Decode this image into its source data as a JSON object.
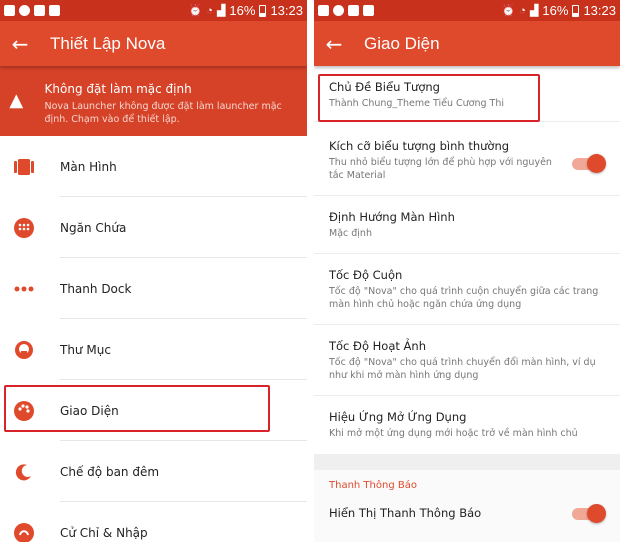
{
  "status_bar": {
    "battery": "16%",
    "time": "13:23"
  },
  "left": {
    "title": "Thiết Lập Nova",
    "warning": {
      "title": "Không đặt làm mặc định",
      "subtitle": "Nova Launcher không được đặt làm launcher mặc định. Chạm vào để thiết lập."
    },
    "items": [
      {
        "label": "Màn Hình"
      },
      {
        "label": "Ngăn Chứa"
      },
      {
        "label": "Thanh Dock"
      },
      {
        "label": "Thư Mục"
      },
      {
        "label": "Giao Diện"
      },
      {
        "label": "Chế độ ban đêm"
      },
      {
        "label": "Cử Chỉ & Nhập"
      }
    ]
  },
  "right": {
    "title": "Giao Diện",
    "rows": [
      {
        "title": "Chủ Đề Biểu Tượng",
        "subtitle": "Thành Chung_Theme Tiểu Cương Thi"
      },
      {
        "title": "Kích cỡ biểu tượng bình thường",
        "subtitle": "Thu nhỏ biểu tượng lớn để phù hợp với nguyên tắc Material",
        "toggle": true
      },
      {
        "title": "Định Hướng Màn Hình",
        "subtitle": "Mặc định"
      },
      {
        "title": "Tốc Độ Cuộn",
        "subtitle": "Tốc độ \"Nova\" cho quá trình cuộn chuyển giữa các trang màn hình chủ hoặc ngăn chứa ứng dụng"
      },
      {
        "title": "Tốc Độ Hoạt Ảnh",
        "subtitle": "Tốc độ \"Nova\" cho quá trình chuyển đổi màn hình, ví dụ như khi mở màn hình ứng dụng"
      },
      {
        "title": "Hiệu Ứng Mở Ứng Dụng",
        "subtitle": "Khi mở một ứng dụng mới hoặc trở về màn hình chủ"
      }
    ],
    "section_header": "Thanh Thông Báo",
    "notif_row": {
      "title": "Hiển Thị Thanh Thông Báo",
      "toggle": true
    }
  },
  "colors": {
    "primary": "#e04a2c",
    "status_bar": "#c8321c",
    "highlight": "#d8232b"
  }
}
